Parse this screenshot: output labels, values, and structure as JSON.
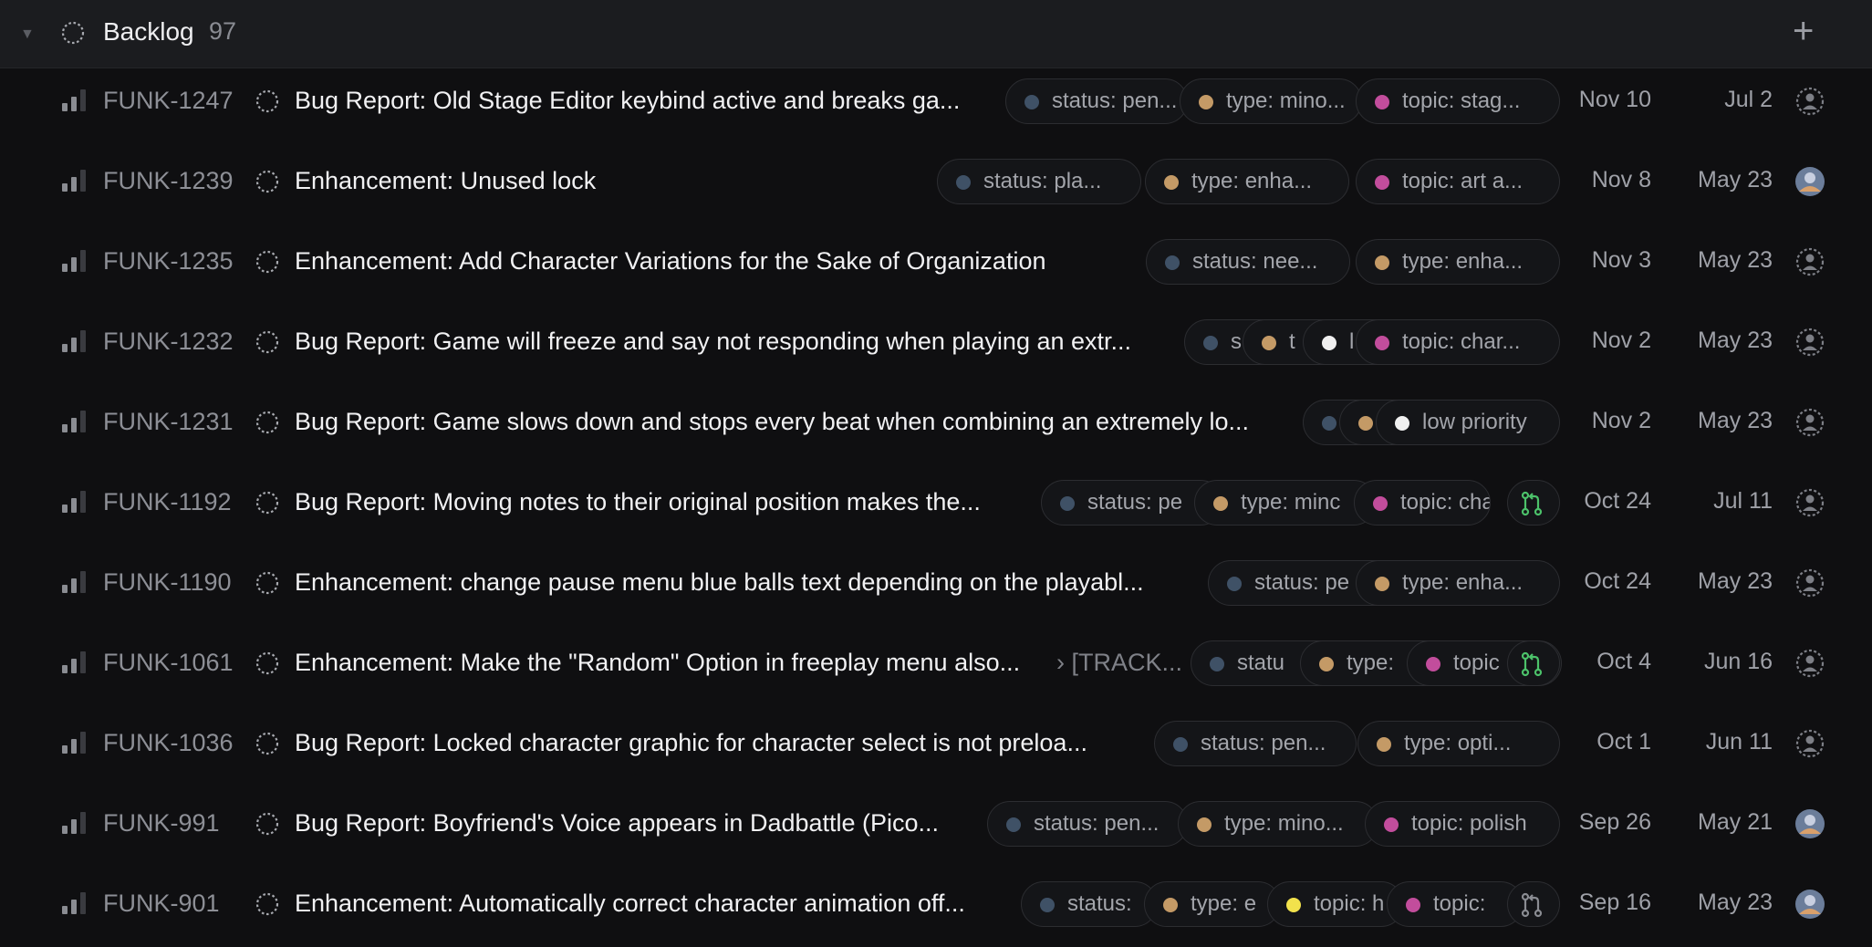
{
  "group": {
    "title": "Backlog",
    "count": "97"
  },
  "colors": {
    "status": "#3f5166",
    "type": "#c49a66",
    "topic": "#c24d9c",
    "white": "#f0f0f0",
    "yellow": "#f2e24c",
    "pr_open": "#4cc26a",
    "pr_draft": "#8a8c92"
  },
  "rows": [
    {
      "id": "FUNK-1247",
      "title": "Bug Report: Old Stage Editor keybind active and breaks ga...",
      "created": "Nov 10",
      "updated": "Jul 2",
      "assignee_icon": "unassigned-icon",
      "labels": [
        {
          "text": "status: pen...",
          "color": "status"
        },
        {
          "text": "type: mino...",
          "color": "type"
        },
        {
          "text": "topic: stag...",
          "color": "topic"
        }
      ]
    },
    {
      "id": "FUNK-1239",
      "title": "Enhancement: Unused lock",
      "created": "Nov 8",
      "updated": "May 23",
      "assignee_icon": "user-avatar-icon",
      "labels": [
        {
          "text": "status: pla...",
          "color": "status"
        },
        {
          "text": "type: enha...",
          "color": "type"
        },
        {
          "text": "topic: art a...",
          "color": "topic"
        }
      ]
    },
    {
      "id": "FUNK-1235",
      "title": "Enhancement: Add Character Variations for the Sake of Organization",
      "created": "Nov 3",
      "updated": "May 23",
      "assignee_icon": "unassigned-icon",
      "labels": [
        {
          "text": "status: nee...",
          "color": "status"
        },
        {
          "text": "type: enha...",
          "color": "type"
        }
      ]
    },
    {
      "id": "FUNK-1232",
      "title": "Bug Report: Game will freeze and say not responding when playing an extr...",
      "created": "Nov 2",
      "updated": "May 23",
      "assignee_icon": "unassigned-icon",
      "labels": [
        {
          "text": "s",
          "color": "status"
        },
        {
          "text": "t",
          "color": "type"
        },
        {
          "text": "l",
          "color": "white"
        },
        {
          "text": "topic: char...",
          "color": "topic"
        }
      ]
    },
    {
      "id": "FUNK-1231",
      "title": "Bug Report: Game slows down and stops every beat when combining an extremely lo...",
      "created": "Nov 2",
      "updated": "May 23",
      "assignee_icon": "unassigned-icon",
      "labels": [
        {
          "text": "",
          "color": "status"
        },
        {
          "text": "",
          "color": "type"
        },
        {
          "text": "low priority",
          "color": "white"
        }
      ]
    },
    {
      "id": "FUNK-1192",
      "title": "Bug Report: Moving notes to their original position makes the...",
      "created": "Oct 24",
      "updated": "Jul 11",
      "assignee_icon": "unassigned-icon",
      "pr": "open",
      "labels": [
        {
          "text": "status: pe",
          "color": "status"
        },
        {
          "text": "type: minc",
          "color": "type"
        },
        {
          "text": "topic: cha",
          "color": "topic"
        }
      ]
    },
    {
      "id": "FUNK-1190",
      "title": "Enhancement: change pause menu blue balls text depending on the playabl...",
      "created": "Oct 24",
      "updated": "May 23",
      "assignee_icon": "unassigned-icon",
      "labels": [
        {
          "text": "status: pe",
          "color": "status"
        },
        {
          "text": "type: enha...",
          "color": "type"
        }
      ]
    },
    {
      "id": "FUNK-1061",
      "title": "Enhancement: Make the \"Random\" Option in freeplay menu also...",
      "parent": "›  [TRACK...",
      "created": "Oct 4",
      "updated": "Jun 16",
      "assignee_icon": "unassigned-icon",
      "pr": "open",
      "labels": [
        {
          "text": "statu",
          "color": "status"
        },
        {
          "text": "type:",
          "color": "type"
        },
        {
          "text": "topic",
          "color": "topic"
        }
      ]
    },
    {
      "id": "FUNK-1036",
      "title": "Bug Report: Locked character graphic for character select is not preloa...",
      "created": "Oct 1",
      "updated": "Jun 11",
      "assignee_icon": "unassigned-icon",
      "labels": [
        {
          "text": "status: pen...",
          "color": "status"
        },
        {
          "text": "type: opti...",
          "color": "type"
        }
      ]
    },
    {
      "id": "FUNK-991",
      "title": "Bug Report: Boyfriend's Voice appears in Dadbattle (Pico...",
      "created": "Sep 26",
      "updated": "May 21",
      "assignee_icon": "user-avatar-icon",
      "labels": [
        {
          "text": "status: pen...",
          "color": "status"
        },
        {
          "text": "type: mino...",
          "color": "type"
        },
        {
          "text": "topic: polish",
          "color": "topic"
        }
      ]
    },
    {
      "id": "FUNK-901",
      "title": "Enhancement: Automatically correct character animation off...",
      "created": "Sep 16",
      "updated": "May 23",
      "assignee_icon": "user-avatar-icon",
      "pr": "draft",
      "labels": [
        {
          "text": "status:",
          "color": "status"
        },
        {
          "text": "type: e",
          "color": "type"
        },
        {
          "text": "topic: h",
          "color": "yellow"
        },
        {
          "text": "topic:",
          "color": "topic"
        }
      ]
    }
  ]
}
